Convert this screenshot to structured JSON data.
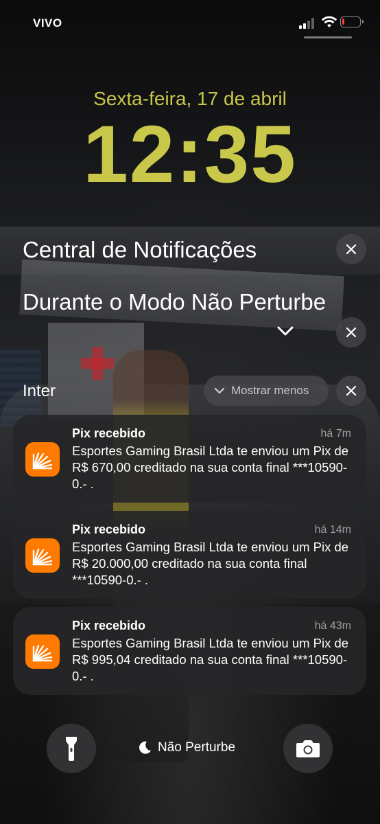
{
  "status_bar": {
    "carrier": "VIVO"
  },
  "lock": {
    "date": "Sexta-feira, 17 de abril",
    "time": "12:35"
  },
  "notification_center": {
    "title": "Central de Notificações",
    "dnd_section_title": "Durante o Modo Não Perturbe",
    "group": {
      "app": "Inter",
      "collapse_label": "Mostrar menos"
    },
    "notifications": [
      {
        "title": "Pix recebido",
        "time": "há 7m",
        "body": "Esportes Gaming Brasil Ltda te enviou um Pix de R$ 670,00 creditado na sua conta final ***10590-0.- ."
      },
      {
        "title": "Pix recebido",
        "time": "há 14m",
        "body": "Esportes Gaming Brasil Ltda te enviou um Pix de R$ 20.000,00 creditado na sua conta final ***10590-0.- ."
      },
      {
        "title": "Pix recebido",
        "time": "há 43m",
        "body": "Esportes Gaming Brasil Ltda te enviou um Pix de R$ 995,04 creditado na sua conta final ***10590-0.- ."
      }
    ]
  },
  "bottom": {
    "focus_label": "Não Perturbe"
  },
  "colors": {
    "clock": "#c9c84a",
    "app_icon": "#ff7a00",
    "battery_low": "#ff3b30"
  },
  "icons": [
    "flashlight-icon",
    "moon-icon",
    "camera-icon",
    "close-icon",
    "chevron-down-icon",
    "wifi-icon",
    "signal-icon",
    "battery-icon"
  ]
}
